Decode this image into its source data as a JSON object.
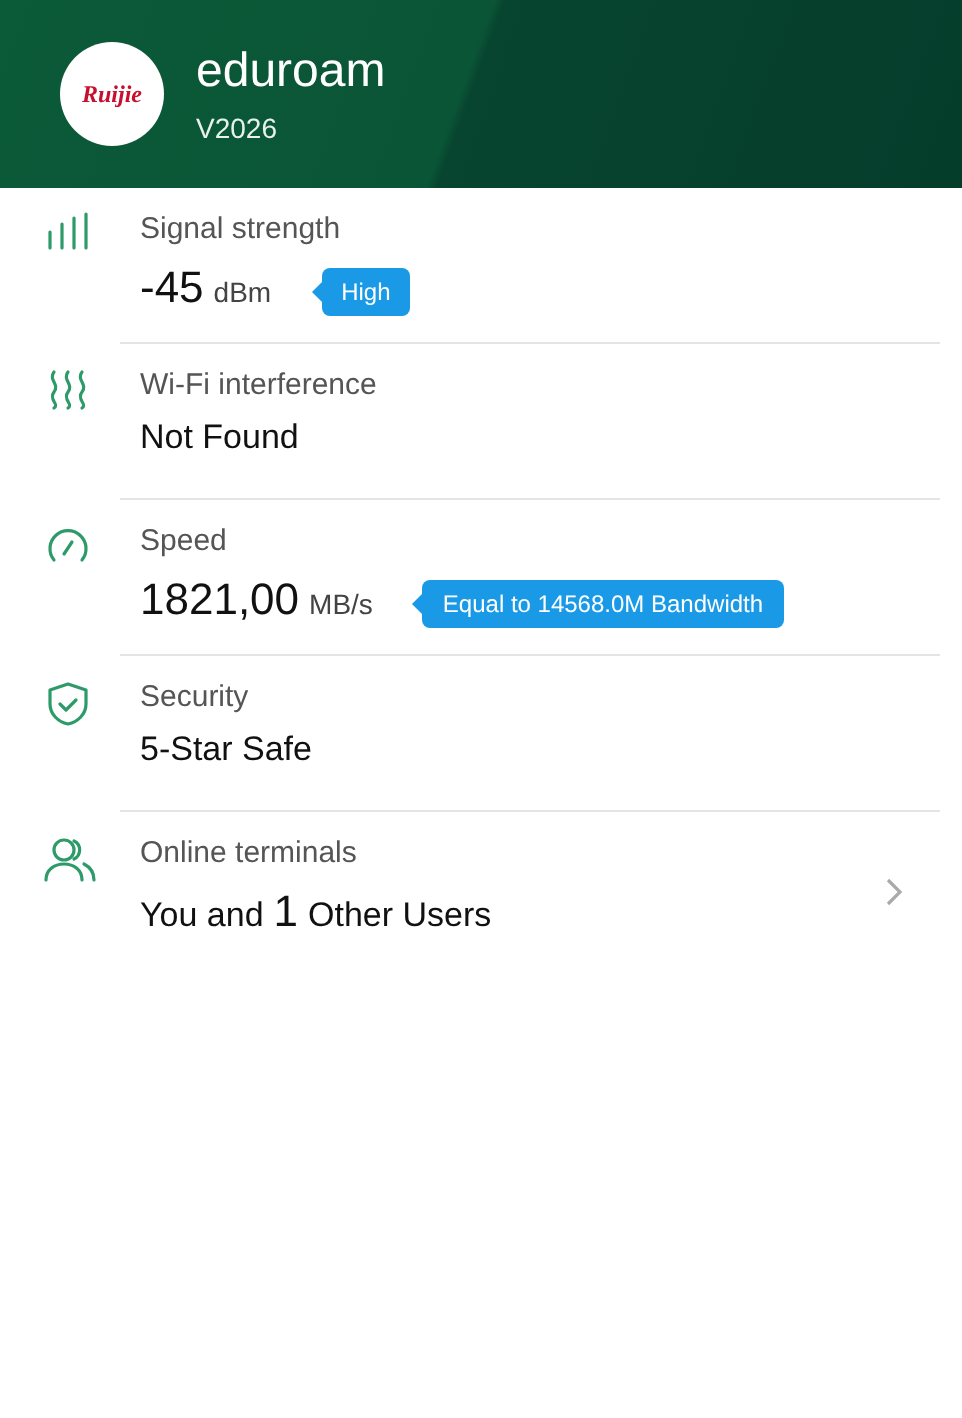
{
  "header": {
    "logo": "Ruijie",
    "title": "eduroam",
    "subtitle": "V2026"
  },
  "rows": [
    {
      "label": "Signal strength",
      "value": [
        {
          "kind": "main",
          "text": "-45"
        },
        {
          "kind": "unit",
          "text": "dBm"
        }
      ],
      "badge": "High",
      "chevron": false
    },
    {
      "label": "Wi-Fi interference",
      "value": [
        {
          "kind": "plain",
          "text": "Not Found"
        }
      ],
      "chevron": false
    },
    {
      "label": "Speed",
      "value": [
        {
          "kind": "main",
          "text": "1821,00"
        },
        {
          "kind": "unit",
          "text": "MB/s"
        }
      ],
      "badge": "Equal to 14568.0M Bandwidth",
      "chevron": false
    },
    {
      "label": "Security",
      "value": [
        {
          "kind": "plain",
          "text": "5-Star Safe"
        }
      ],
      "chevron": false
    },
    {
      "label": "Online terminals",
      "value": [
        {
          "kind": "plain",
          "text": "You and"
        },
        {
          "kind": "main",
          "text": "1"
        },
        {
          "kind": "plain",
          "text": "Other Users"
        }
      ],
      "chevron": true
    }
  ]
}
